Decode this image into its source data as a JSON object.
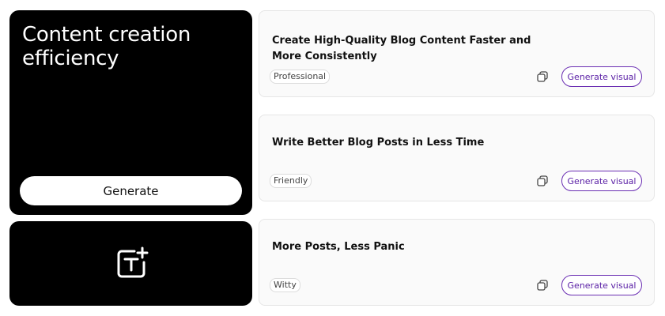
{
  "hero": {
    "title": "Content creation efficiency",
    "generate_label": "Generate"
  },
  "tool": {
    "icon": "text-add-icon"
  },
  "results": [
    {
      "title": "Create High-Quality Blog Content Faster and More Consistently",
      "tone": "Professional",
      "copy_icon": "copy-icon",
      "action_label": "Generate visual"
    },
    {
      "title": "Write Better Blog Posts in Less Time",
      "tone": "Friendly",
      "copy_icon": "copy-icon",
      "action_label": "Generate visual"
    },
    {
      "title": "More Posts, Less Panic",
      "tone": "Witty",
      "copy_icon": "copy-icon",
      "action_label": "Generate visual"
    }
  ],
  "colors": {
    "hero_bg": "#000000",
    "accent": "#5b21a6",
    "card_bg": "#fafafa"
  }
}
